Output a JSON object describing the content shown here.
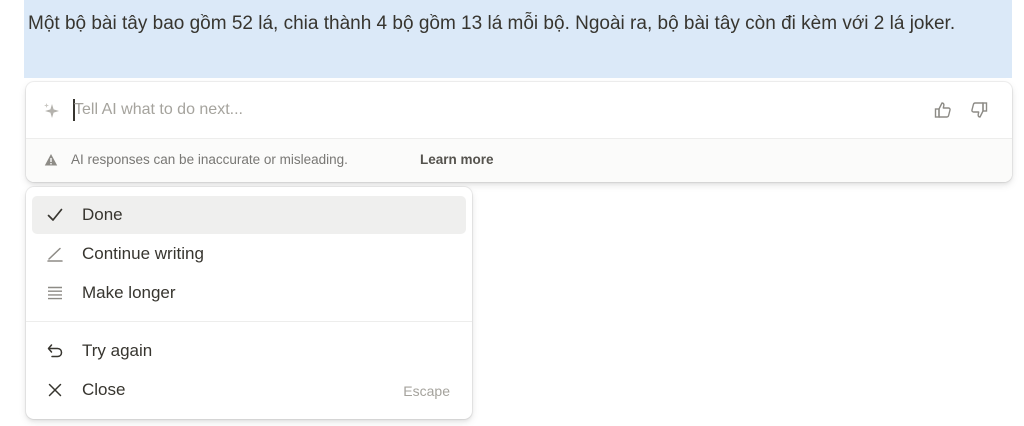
{
  "document": {
    "highlighted_text": "Một bộ bài tây bao gồm 52 lá, chia thành 4 bộ gồm 13 lá mỗi bộ. Ngoài ra, bộ bài tây còn đi kèm với 2 lá joker."
  },
  "ai_panel": {
    "input_value": "",
    "placeholder": "Tell AI what to do next...",
    "disclaimer": "AI responses can be inaccurate or misleading.",
    "learn_more": "Learn more"
  },
  "menu": {
    "items": [
      {
        "label": "Done",
        "icon": "check-icon",
        "selected": true
      },
      {
        "label": "Continue writing",
        "icon": "pen-icon"
      },
      {
        "label": "Make longer",
        "icon": "lines-icon"
      }
    ],
    "secondary_items": [
      {
        "label": "Try again",
        "icon": "undo-arrow-icon"
      },
      {
        "label": "Close",
        "icon": "close-icon",
        "shortcut": "Escape"
      }
    ]
  },
  "colors": {
    "highlight": "#dbe9f8",
    "text": "#37352f",
    "muted": "#787774",
    "selected_bg": "#efefee"
  }
}
